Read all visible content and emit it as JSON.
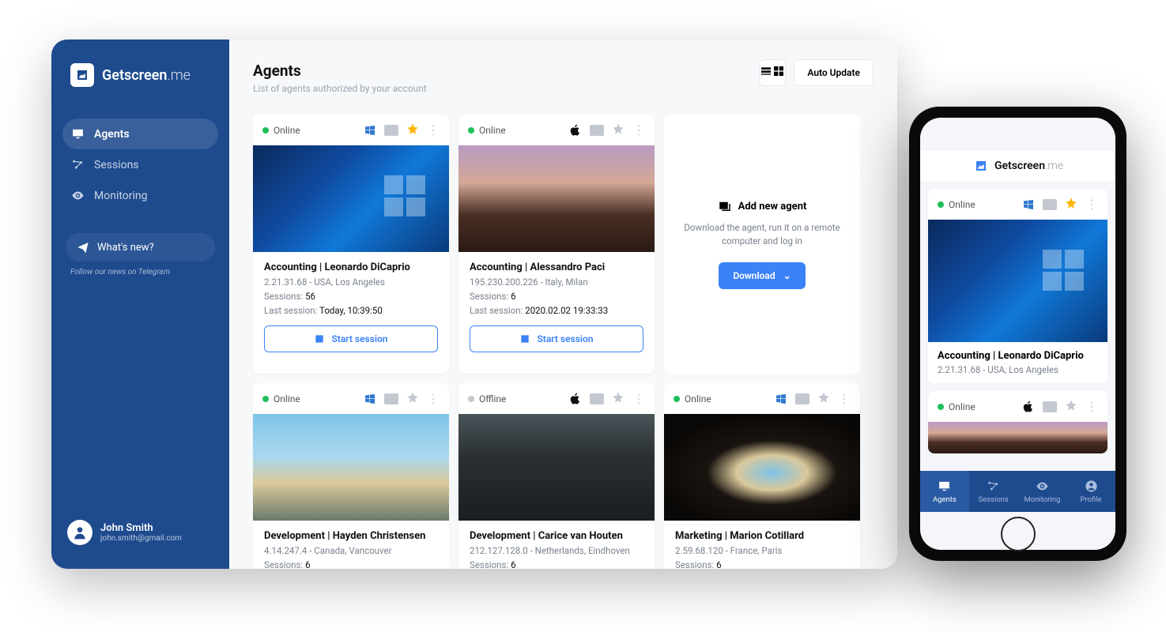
{
  "brand": {
    "name_a": "Getscreen",
    "name_b": ".me"
  },
  "sidebar": {
    "items": [
      {
        "label": "Agents"
      },
      {
        "label": "Sessions"
      },
      {
        "label": "Monitoring"
      }
    ],
    "whatsnew": "What's new?",
    "follow": "Follow our news on Telegram"
  },
  "user": {
    "name": "John Smith",
    "email": "john.smith@gmail.com"
  },
  "page": {
    "title": "Agents",
    "subtitle": "List of agents authorized by your account"
  },
  "toolbar": {
    "auto_update": "Auto Update"
  },
  "labels": {
    "online": "Online",
    "offline": "Offline",
    "sessions": "Sessions:",
    "last_session": "Last session:",
    "start_session": "Start session",
    "add_title": "Add new agent",
    "add_desc": "Download the agent, run it on a remote computer and log in",
    "download": "Download"
  },
  "agents": [
    {
      "status": "online",
      "os": "windows",
      "fav": true,
      "title": "Accounting | Leonardo DiCaprio",
      "ip": "2.21.31.68 - USA, Los Angeles",
      "sessions": "56",
      "last": "Today, 10:39:50",
      "thumb": "windows"
    },
    {
      "status": "online",
      "os": "apple",
      "fav": false,
      "title": "Accounting | Alessandro Paci",
      "ip": "195.230.200.226 - Italy, Milan",
      "sessions": "6",
      "last": "2020.02.02 19:33:33",
      "thumb": "dune"
    },
    {
      "status": "online",
      "os": "windows",
      "fav": false,
      "title": "Development | Hayden Christensen",
      "ip": "4.14.247.4 - Canada, Vancouver",
      "sessions": "6",
      "thumb": "beach"
    },
    {
      "status": "offline",
      "os": "apple",
      "fav": false,
      "title": "Development | Carice van Houten",
      "ip": "212.127.128.0 - Netherlands, Eindhoven",
      "sessions": "6",
      "thumb": "valley"
    },
    {
      "status": "online",
      "os": "windows",
      "fav": false,
      "title": "Marketing | Marion Cotillard",
      "ip": "2.59.68.120 - France, Paris",
      "sessions": "6",
      "thumb": "cave"
    }
  ],
  "phone": {
    "tabs": [
      "Agents",
      "Sessions",
      "Monitoring",
      "Profile"
    ],
    "cards": [
      {
        "status": "online",
        "os": "windows",
        "fav": true,
        "title": "Accounting | Leonardo DiCaprio",
        "ip": "2.21.31.68 - USA, Los Angeles",
        "thumb": "windows"
      },
      {
        "status": "online",
        "os": "apple",
        "fav": false,
        "thumb": "dune"
      }
    ]
  }
}
